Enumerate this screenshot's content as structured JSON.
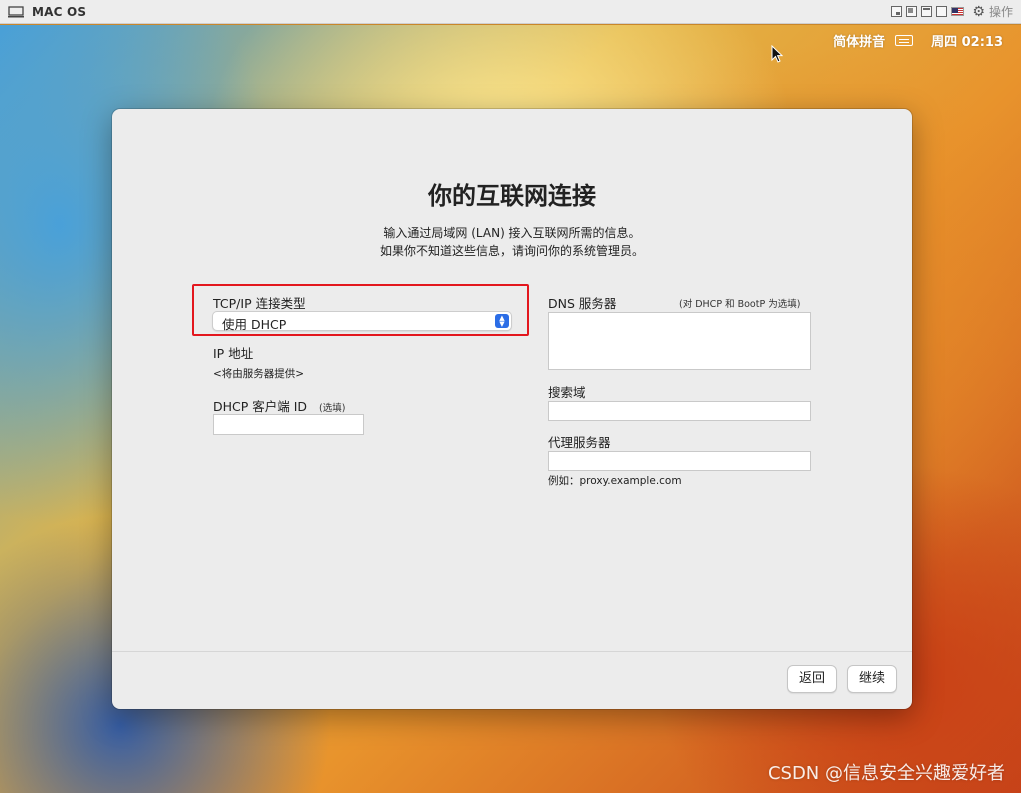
{
  "host": {
    "title": "MAC OS",
    "ops_label": "操作"
  },
  "menubar": {
    "input_method": "简体拼音",
    "clock": "周四 02:13"
  },
  "window": {
    "title": "你的互联网连接",
    "description_line1": "输入通过局域网 (LAN) 接入互联网所需的信息。",
    "description_line2": "如果你不知道这些信息，请询问你的系统管理员。",
    "tcpip": {
      "label": "TCP/IP 连接类型",
      "selected": "使用 DHCP"
    },
    "ip": {
      "label": "IP 地址",
      "value": "<将由服务器提供>"
    },
    "dhcp_client": {
      "label": "DHCP 客户端 ID",
      "note": "(选填)",
      "value": ""
    },
    "dns": {
      "label": "DNS 服务器",
      "note": "(对 DHCP 和 BootP 为选填)",
      "value": ""
    },
    "search_domain": {
      "label": "搜索域",
      "value": ""
    },
    "proxy": {
      "label": "代理服务器",
      "value": "",
      "example": "例如：proxy.example.com"
    },
    "buttons": {
      "back": "返回",
      "continue": "继续"
    }
  },
  "watermark": "CSDN @信息安全兴趣爱好者",
  "colors": {
    "highlight": "#e3171e",
    "select_accent": "#2b6de6"
  }
}
